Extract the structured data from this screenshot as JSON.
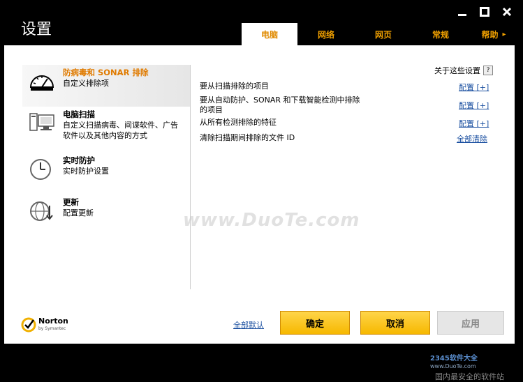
{
  "window": {
    "title": "设置"
  },
  "tabs": [
    {
      "label": "电脑"
    },
    {
      "label": "网络"
    },
    {
      "label": "网页"
    },
    {
      "label": "常规"
    },
    {
      "label": "帮助"
    }
  ],
  "sidebar": {
    "items": [
      {
        "title": "防病毒和 SONAR 排除",
        "desc": "自定义排除项"
      },
      {
        "title": "电脑扫描",
        "desc": "自定义扫描病毒、间谍软件、广告软件以及其他内容的方式"
      },
      {
        "title": "实时防护",
        "desc": "实时防护设置"
      },
      {
        "title": "更新",
        "desc": "配置更新"
      }
    ]
  },
  "content": {
    "about": "关于这些设置",
    "about_btn": "?",
    "rows": [
      {
        "label": "要从扫描排除的项目",
        "action": "配置 [+]"
      },
      {
        "label": "要从自动防护、SONAR 和下载智能检测中排除的项目",
        "action": "配置 [+]"
      },
      {
        "label": "从所有检测排除的特征",
        "action": "配置 [+]"
      },
      {
        "label": "清除扫描期间排除的文件 ID",
        "action": "全部清除"
      }
    ]
  },
  "footer": {
    "defaults_link": "全部默认",
    "ok": "确定",
    "cancel": "取消",
    "apply": "应用",
    "logo_text": "Norton",
    "logo_sub": "by Symantec"
  },
  "watermarks": {
    "main": "www.DuoTe.com",
    "site": "www.DuoTe.com",
    "brand": "2345软件大全",
    "tagline": "国内最安全的软件站"
  },
  "colors": {
    "accent": "#F0A000",
    "link": "#1A4FA0",
    "active_title": "#E07B00"
  }
}
